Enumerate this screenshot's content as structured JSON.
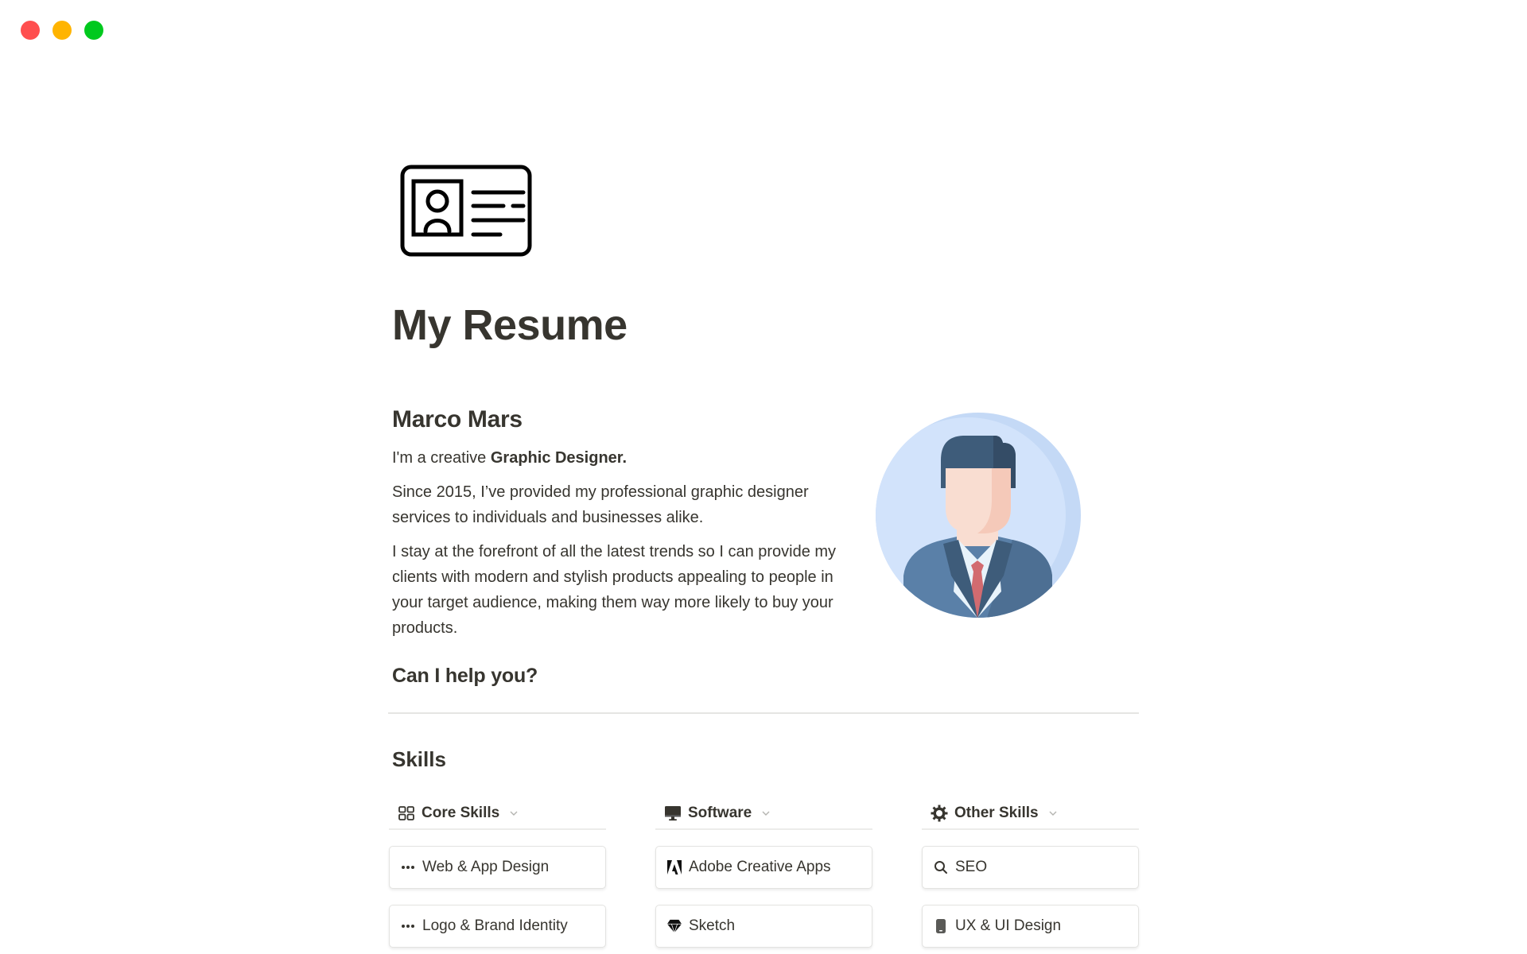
{
  "window": {
    "controls": [
      {
        "name": "close",
        "color": "#ff4f4f"
      },
      {
        "name": "minimize",
        "color": "#ffb400"
      },
      {
        "name": "maximize",
        "color": "#00c91e"
      }
    ]
  },
  "page": {
    "icon": "id-card-icon",
    "title": "My Resume"
  },
  "bio": {
    "name": "Marco Mars",
    "intro_prefix": "I'm a creative ",
    "intro_bold": "Graphic Designer.",
    "paragraph_1": "Since 2015, I’ve provided my professional graphic designer services to individuals and businesses alike.",
    "paragraph_2": "I stay at the forefront of all the latest trends so I can provide my clients with modern and stylish products appealing to people in your target audience, making them way more likely to buy your products.",
    "help_heading": "Can I help you?",
    "avatar": "businessman-avatar-icon"
  },
  "skills": {
    "title": "Skills",
    "columns": [
      {
        "label": "Core Skills",
        "icon": "grid-icon",
        "items": [
          {
            "label": "Web & App Design",
            "icon": "ellipsis-icon"
          },
          {
            "label": "Logo & Brand Identity",
            "icon": "ellipsis-icon"
          }
        ]
      },
      {
        "label": "Software",
        "icon": "monitor-icon",
        "items": [
          {
            "label": "Adobe Creative Apps",
            "icon": "adobe-icon"
          },
          {
            "label": "Sketch",
            "icon": "diamond-icon"
          }
        ]
      },
      {
        "label": "Other Skills",
        "icon": "gear-icon",
        "items": [
          {
            "label": "SEO",
            "icon": "search-icon"
          },
          {
            "label": "UX & UI Design",
            "icon": "phone-icon"
          }
        ]
      }
    ]
  },
  "colors": {
    "text": "#37352f",
    "divider": "#e5e5e3",
    "avatar_bg": "#d2e3fb",
    "suit": "#5a80a8",
    "hair": "#3e5c7a",
    "tie": "#d26b70"
  }
}
